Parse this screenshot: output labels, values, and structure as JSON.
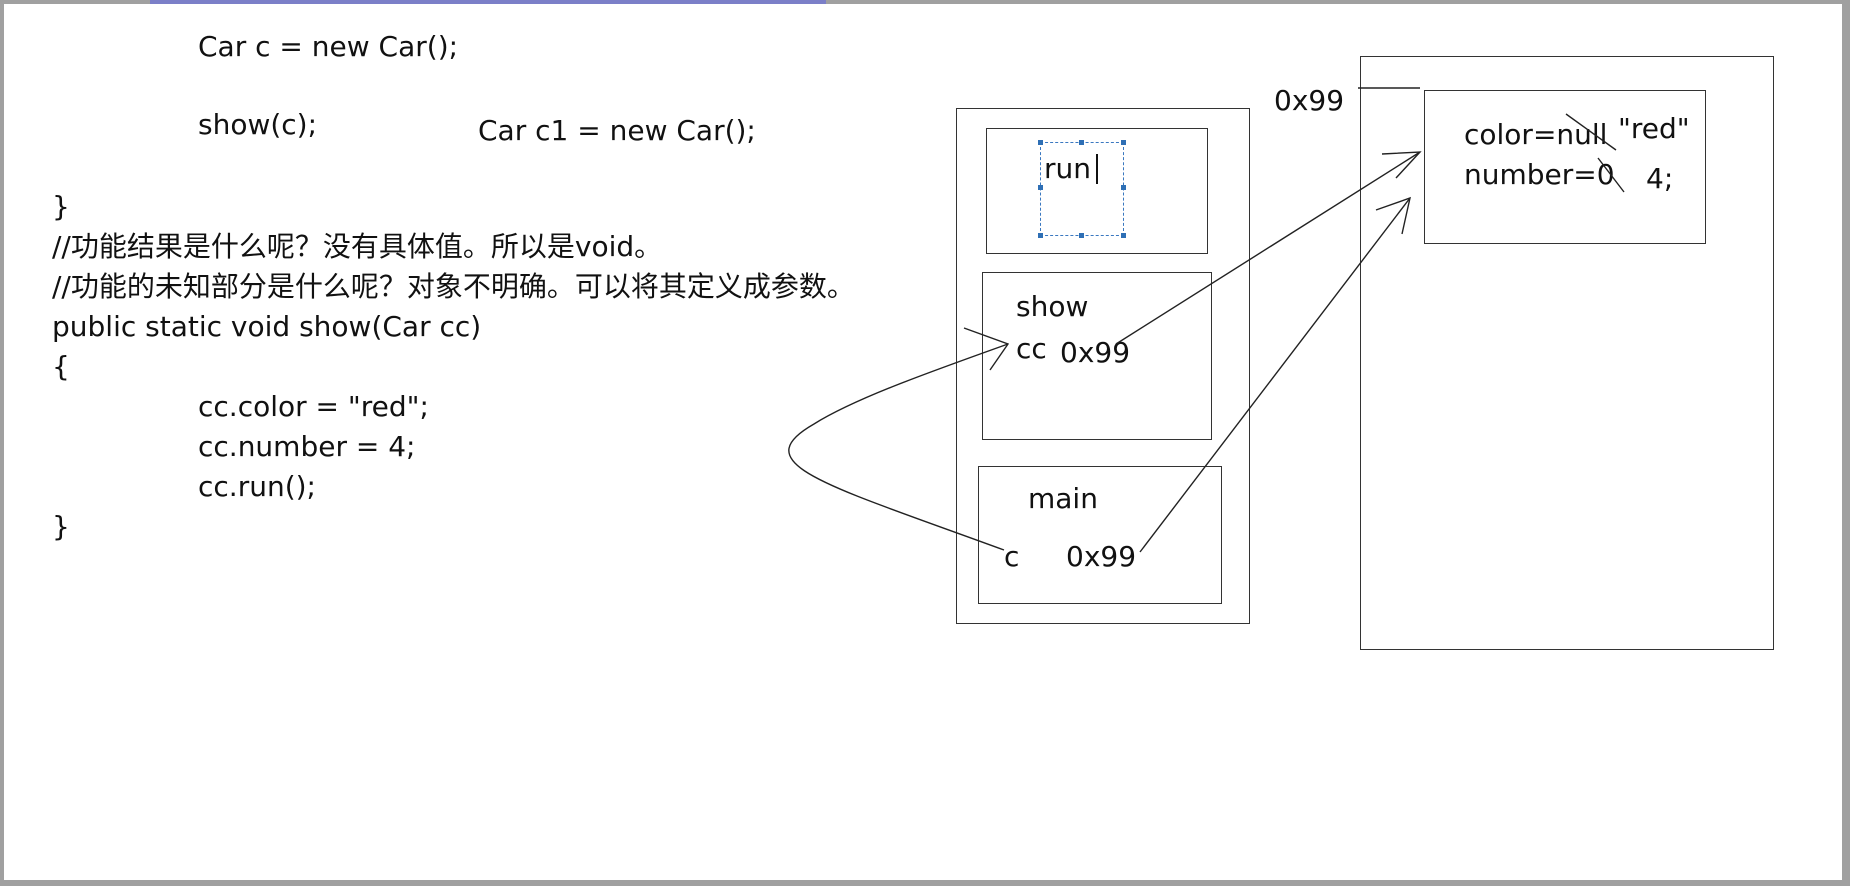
{
  "code": {
    "line1": "Car c = new Car();",
    "line2": "show(c);",
    "line3": "Car c1 = new Car();",
    "line4": "}",
    "comment1": "//功能结果是什么呢？没有具体值。所以是void。",
    "comment2": "//功能的未知部分是什么呢？对象不明确。可以将其定义成参数。",
    "signature": "public static void show(Car cc)",
    "open_brace": "{",
    "stmt1": "cc.color = \"red\";",
    "stmt2": "cc.number = 4;",
    "stmt3": "cc.run();",
    "close_brace": "}"
  },
  "stack": {
    "run_frame": {
      "label": "run"
    },
    "show_frame": {
      "label": "show",
      "var": "cc",
      "value": "0x99"
    },
    "main_frame": {
      "label": "main",
      "var": "c",
      "value": "0x99"
    }
  },
  "heap": {
    "address": "0x99",
    "field1": "color=null",
    "field1_new": "\"red\"",
    "field2": "number=0",
    "field2_new": "4;"
  }
}
